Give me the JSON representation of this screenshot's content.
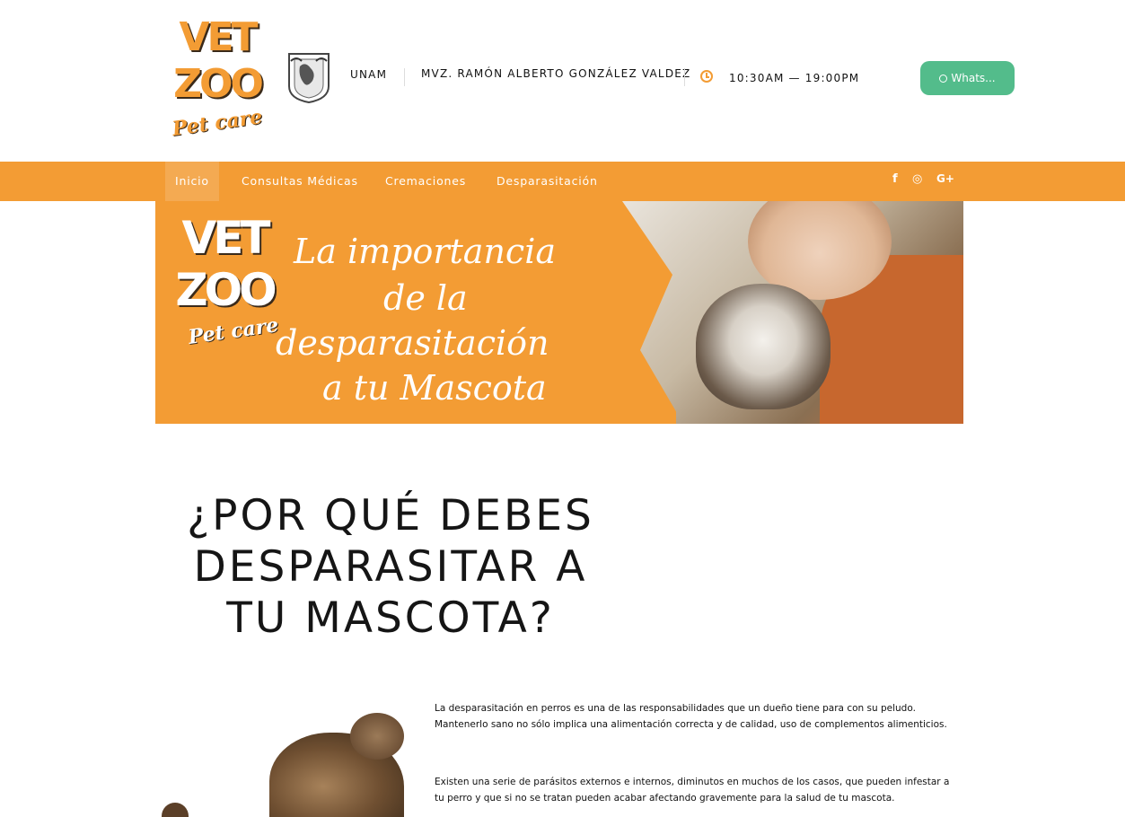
{
  "brand": {
    "logo_line1": "VET",
    "logo_line2": "ZOO",
    "logo_line3": "Pet care",
    "accent_color": "#f39c34",
    "whatsapp_color": "#53bc8b"
  },
  "header": {
    "institution": "UNAM",
    "doctor": "MVZ. RAMÓN ALBERTO GONZÁLEZ VALDEZ",
    "hours": "10:30AM — 19:00PM",
    "whatsapp_label": "Whats..."
  },
  "nav": {
    "items": [
      {
        "label": "Inicio",
        "active": true
      },
      {
        "label": "Consultas Médicas"
      },
      {
        "label": "Cremaciones"
      },
      {
        "label": "Desparasitación"
      }
    ],
    "social": {
      "facebook": "f",
      "whatsapp": "◎",
      "google": "G+"
    }
  },
  "banner": {
    "logo_line1": "VET",
    "logo_line2": "ZOO",
    "logo_line3": "Pet care",
    "lines": [
      "La importancia",
      "de la",
      "desparasitación",
      "a tu Mascota"
    ]
  },
  "main": {
    "heading_lines": [
      "¿POR QUÉ DEBES",
      "DESPARASITAR A",
      "TU MASCOTA?"
    ],
    "paragraphs": [
      "La desparasitación en perros es una de las responsabilidades que un dueño tiene para con su peludo. Mantenerlo sano no sólo implica una alimentación correcta y de calidad, uso de complementos alimenticios.",
      "Existen una serie de parásitos externos e internos, diminutos en muchos de los casos, que pueden infestar a tu perro y que si no se tratan pueden acabar afectando gravemente para la salud de tu mascota."
    ]
  }
}
